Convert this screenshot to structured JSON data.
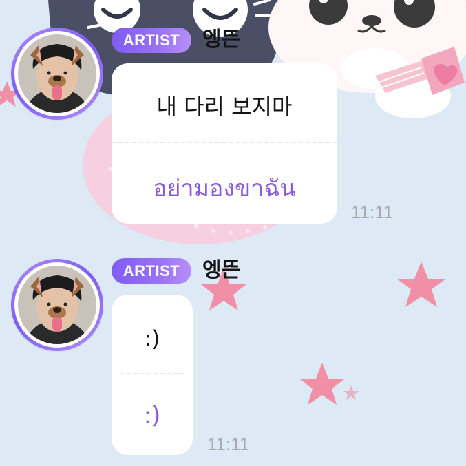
{
  "messages": [
    {
      "badge": "ARTIST",
      "username": "엥뜬",
      "original": "내 다리 보지마",
      "translation": "อย่ามองขาฉัน",
      "time": "11:11"
    },
    {
      "badge": "ARTIST",
      "username": "엥뜬",
      "original": ":)",
      "translation": ":)",
      "time": "11:11"
    }
  ],
  "colors": {
    "badge_gradient_start": "#7f5df3",
    "badge_gradient_end": "#b68ff8",
    "translation_text": "#8a5cd8",
    "background": "#dde9f5",
    "star": "#f08fa5"
  },
  "icons": [
    "avatar-photo",
    "star-decoration",
    "cat-character",
    "bunny-character"
  ]
}
